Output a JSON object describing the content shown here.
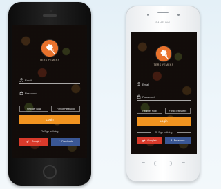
{
  "app": {
    "name": "TERS YEMEKS",
    "email_placeholder": "Email",
    "password_placeholder": "Password",
    "register_label": "Register Now",
    "forgot_label": "Forgot Password",
    "login_label": "Login",
    "divider_label": "Or Sign In Using",
    "google_label": "Google+",
    "google_icon": "g+",
    "facebook_label": "Facebook",
    "facebook_icon": "f"
  },
  "devices": {
    "samsung_brand": "SAMSUNG"
  },
  "colors": {
    "accent_orange": "#f29420",
    "logo_orange": "#e9722c",
    "google_red": "#d93a2b",
    "facebook_blue": "#3a5795"
  },
  "icons": {
    "logo": "chef-hat-utensils-icon",
    "email": "user-icon",
    "password": "lock-icon"
  }
}
